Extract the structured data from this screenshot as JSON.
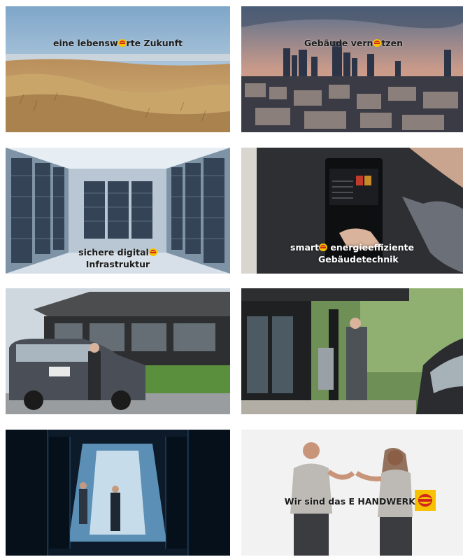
{
  "tiles": [
    {
      "id": "dunes",
      "caption": [
        "eine lebensw",
        "rte Zukunft"
      ]
    },
    {
      "id": "city",
      "caption": [
        "Gebäude vern",
        "tzen"
      ]
    },
    {
      "id": "server-room",
      "caption_line1": "sichere digital",
      "caption_line2": "Infrastruktur"
    },
    {
      "id": "touch-panel",
      "caption_line1_a": "smart",
      "caption_line1_b": " energieeffiziente",
      "caption_line2": "Gebäudetechnik"
    },
    {
      "id": "house-van"
    },
    {
      "id": "wallbox"
    },
    {
      "id": "datacenter"
    },
    {
      "id": "team",
      "caption": "Wir sind das E HANDWERK"
    }
  ],
  "colors": {
    "logo_yellow": "#f6c200",
    "logo_red": "#d2261f"
  },
  "icons": [
    "e-handwerk-logo"
  ]
}
